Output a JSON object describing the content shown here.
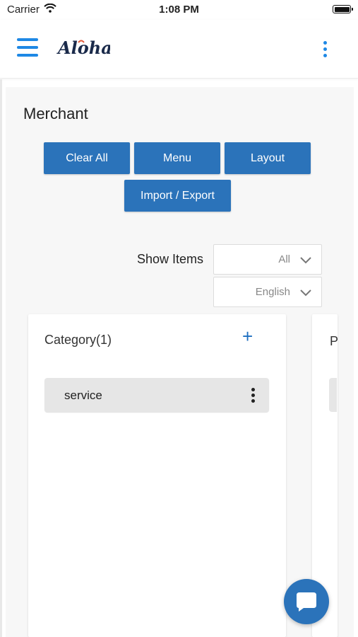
{
  "status_bar": {
    "carrier": "Carrier",
    "time": "1:08 PM"
  },
  "header": {
    "logo_text": "Aloha",
    "brand_color": "#1e88e5"
  },
  "page": {
    "title": "Merchant"
  },
  "actions": {
    "clear_all": "Clear All",
    "menu": "Menu",
    "layout": "Layout",
    "import_export": "Import / Export"
  },
  "filters": {
    "show_items_label": "Show Items",
    "show_items_value": "All",
    "language_value": "English"
  },
  "category": {
    "title": "Category(1)",
    "add_symbol": "+",
    "items": [
      {
        "label": "service"
      }
    ]
  },
  "second_column": {
    "title_partial": "P"
  },
  "colors": {
    "button": "#2b73ba",
    "chat": "#2b73ba"
  },
  "icons": {
    "menu": "hamburger-icon",
    "more": "kebab-icon",
    "add": "plus-icon",
    "dropdown": "chevron-down-icon",
    "chat": "chat-bubble-icon",
    "wifi": "wifi-icon",
    "battery": "battery-icon"
  }
}
